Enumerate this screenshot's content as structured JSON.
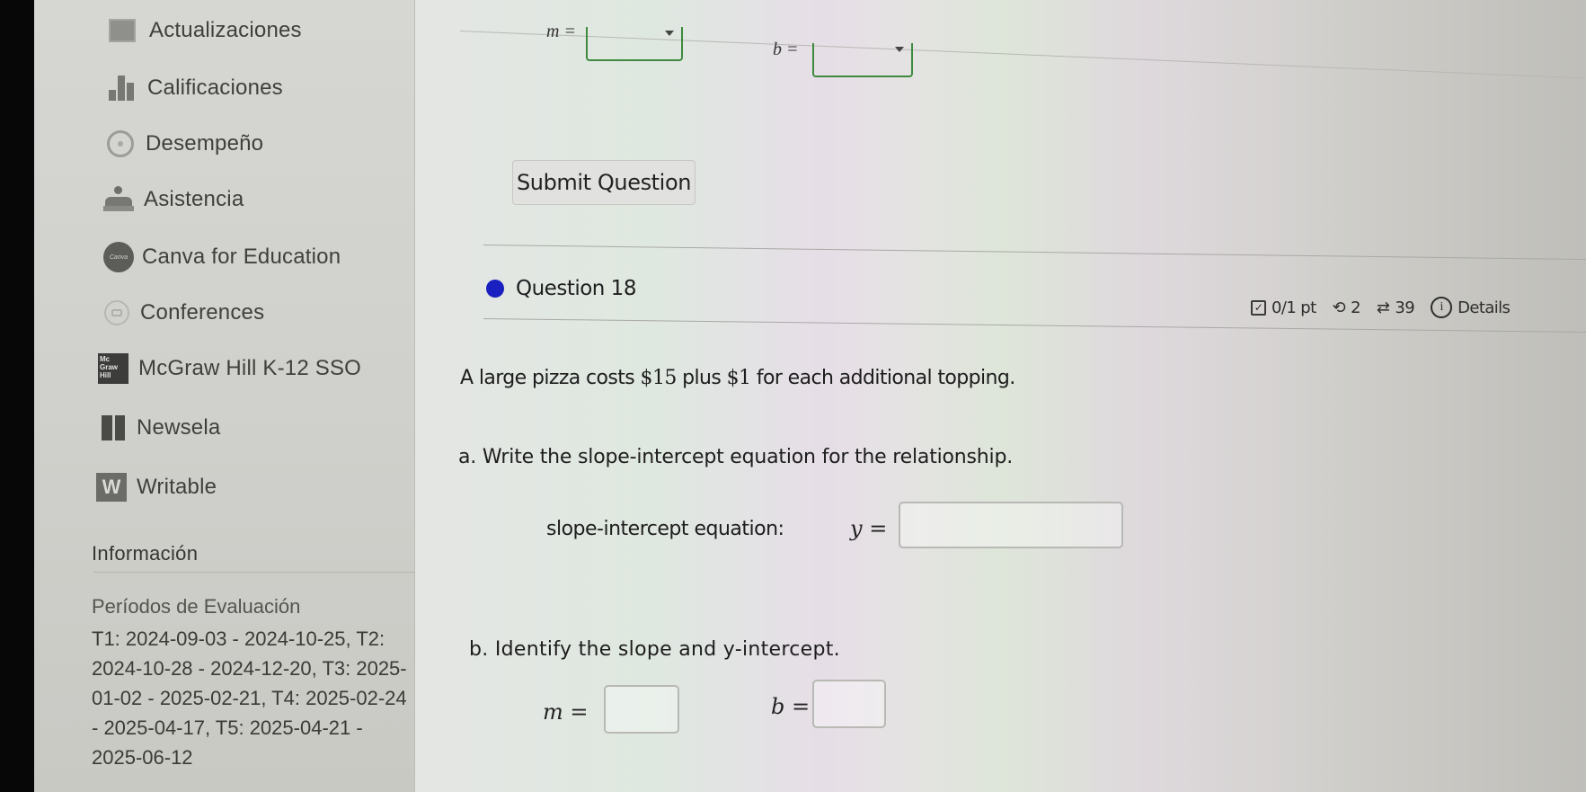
{
  "sidebar": {
    "items": [
      {
        "label": "Actualizaciones",
        "icon": "updates-icon"
      },
      {
        "label": "Calificaciones",
        "icon": "grades-icon"
      },
      {
        "label": "Desempeño",
        "icon": "performance-icon"
      },
      {
        "label": "Asistencia",
        "icon": "attendance-icon"
      },
      {
        "label": "Canva for Education",
        "icon": "canva-icon",
        "icon_text": "Canva"
      },
      {
        "label": "Conferences",
        "icon": "conferences-icon"
      },
      {
        "label": "McGraw Hill K-12 SSO",
        "icon": "mcgraw-hill-icon",
        "icon_text": "Mc Graw Hill"
      },
      {
        "label": "Newsela",
        "icon": "newsela-icon"
      },
      {
        "label": "Writable",
        "icon": "writable-icon",
        "icon_text": "W"
      }
    ],
    "info_heading": "Información",
    "periods_heading": "Períodos de Evaluación",
    "periods_text": "T1: 2024-09-03 - 2024-10-25, T2: 2024-10-28 - 2024-12-20, T3: 2025-01-02 - 2025-02-21, T4: 2025-02-24 - 2025-04-17, T5: 2025-04-21 - 2025-06-12"
  },
  "previous_question": {
    "m_label": "m =",
    "b_label": "b =",
    "submit_label": "Submit Question"
  },
  "question": {
    "title": "Question 18",
    "score": "0/1 pt",
    "retries": "2",
    "attempts": "39",
    "details_label": "Details",
    "problem_pre": "A large pizza costs ",
    "price_base": "$15",
    "problem_mid": " plus ",
    "price_topping": "$1",
    "problem_post": " for each additional topping.",
    "part_a": "a.  Write the slope-intercept equation for the relationship.",
    "slope_label": "slope-intercept equation:",
    "y_label": "y =",
    "y_value": "",
    "part_b": "b.  Identify the slope and y-intercept.",
    "m_label": "m =",
    "m_value": "",
    "b_label": "b =",
    "b_value": ""
  },
  "colors": {
    "question_dot": "#1a1fbf",
    "dropdown_border": "#3e8a3e"
  }
}
